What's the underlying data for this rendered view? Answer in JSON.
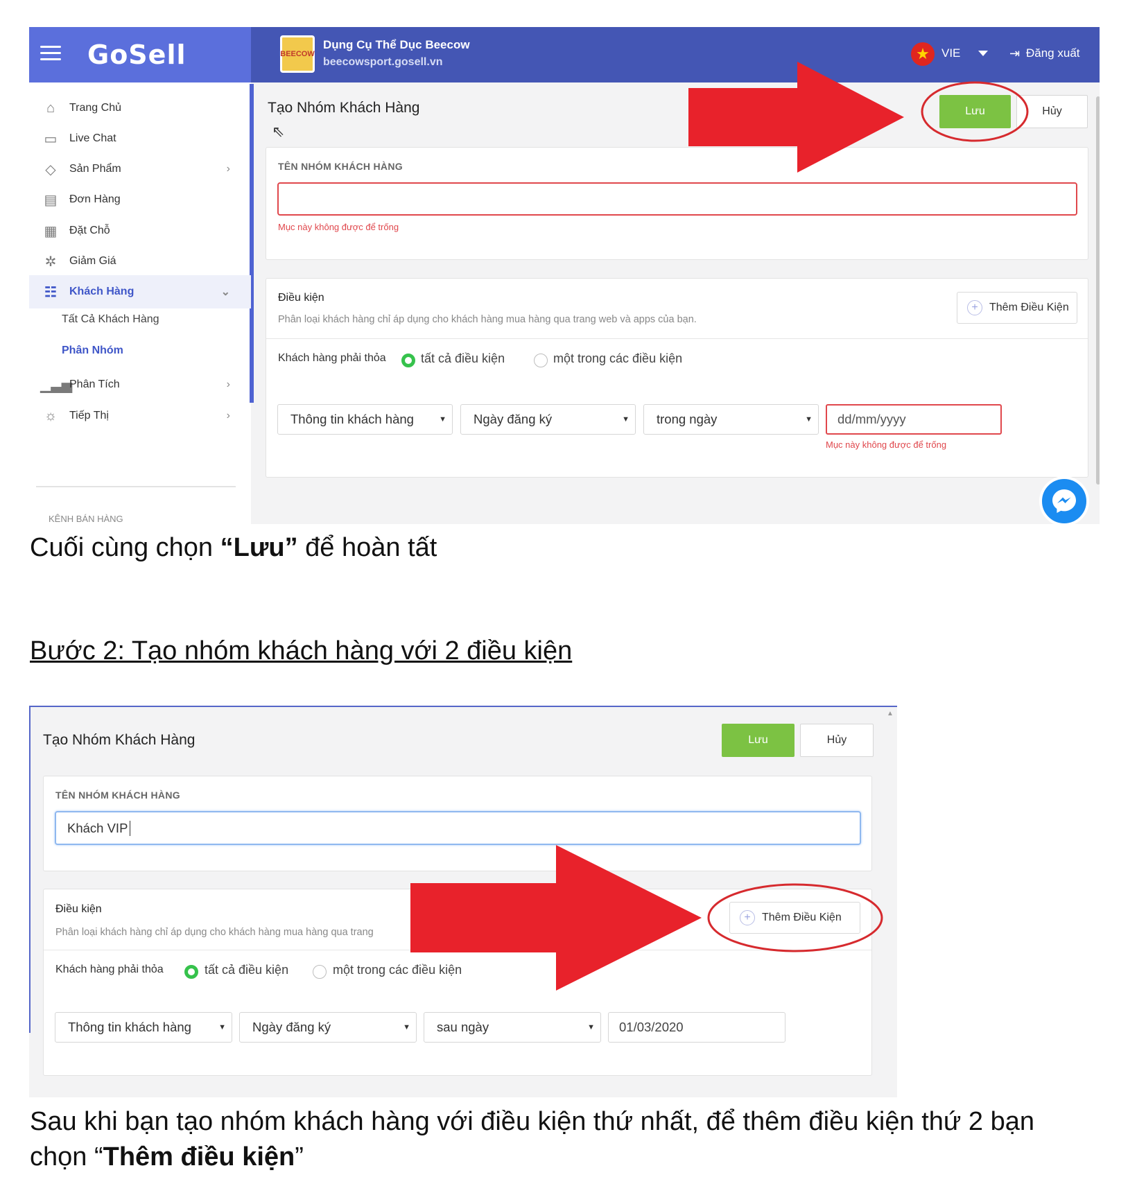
{
  "shot1": {
    "header": {
      "logo": "GoSell",
      "store_logo_text": "BEECOW",
      "store_name": "Dụng Cụ Thể Dục Beecow",
      "store_url": "beecowsport.gosell.vn",
      "language": "VIE",
      "logout": "Đăng xuất"
    },
    "sidebar": {
      "items": [
        {
          "label": "Trang Chủ",
          "icon": "home-icon"
        },
        {
          "label": "Live Chat",
          "icon": "chat-icon"
        },
        {
          "label": "Sản Phẩm",
          "icon": "tag-icon"
        },
        {
          "label": "Đơn Hàng",
          "icon": "receipt-icon"
        },
        {
          "label": "Đặt Chỗ",
          "icon": "calendar-icon"
        },
        {
          "label": "Giảm Giá",
          "icon": "discount-icon"
        },
        {
          "label": "Khách Hàng",
          "icon": "users-icon"
        },
        {
          "label": "Phân Tích",
          "icon": "analytics-icon"
        },
        {
          "label": "Tiếp Thị",
          "icon": "lightbulb-icon"
        }
      ],
      "sub_items": [
        "Tất Cả Khách Hàng",
        "Phân Nhóm"
      ],
      "section_label": "KÊNH BÁN HÀNG"
    },
    "form": {
      "title": "Tạo Nhóm Khách Hàng",
      "save": "Lưu",
      "cancel": "Hủy",
      "name_label": "TÊN NHÓM KHÁCH HÀNG",
      "name_error": "Mục này không được để trống",
      "cond_title": "Điều kiện",
      "cond_desc": "Phân loại khách hàng chỉ áp dụng cho khách hàng mua hàng qua trang web và apps của bạn.",
      "add_cond": "Thêm Điều Kiện",
      "must_label": "Khách hàng phải thỏa",
      "radio_all": "tất cả điều kiện",
      "radio_any": "một trong các điều kiện",
      "select1": "Thông tin khách hàng",
      "select2": "Ngày đăng ký",
      "select3": "trong ngày",
      "date_placeholder": "dd/mm/yyyy",
      "date_error": "Mục này không được để trống"
    }
  },
  "caption1_pre": "Cuối cùng chọn ",
  "caption1_bold": "“Lưu”",
  "caption1_post": " để hoàn tất",
  "step2_heading": "Bước 2: Tạo nhóm khách hàng với 2 điều kiện",
  "shot2": {
    "form": {
      "title": "Tạo Nhóm Khách Hàng",
      "save": "Lưu",
      "cancel": "Hủy",
      "name_label": "TÊN NHÓM KHÁCH HÀNG",
      "name_value": "Khách VIP",
      "cond_title": "Điều kiện",
      "cond_desc": "Phân loại khách hàng chỉ áp dụng cho khách hàng mua hàng qua trang",
      "add_cond": "Thêm Điều Kiện",
      "must_label": "Khách hàng phải thỏa",
      "radio_all": "tất cả điều kiện",
      "radio_any": "một trong các điều kiện",
      "select1": "Thông tin khách hàng",
      "select2": "Ngày đăng ký",
      "select3": "sau ngày",
      "date_value": "01/03/2020"
    }
  },
  "caption2_line1": "Sau khi bạn tạo nhóm khách hàng với điều kiện thứ nhất, để thêm điều kiện thứ 2 bạn",
  "caption2_pre": "chọn “",
  "caption2_bold": "Thêm điều kiện",
  "caption2_post": "”",
  "colors": {
    "header": "#4456b4",
    "brand": "#5b6fdc",
    "save_green": "#7cc243",
    "error_red": "#e0474c",
    "annotation_red": "#e8222b",
    "active_blue": "#3f56c8"
  }
}
